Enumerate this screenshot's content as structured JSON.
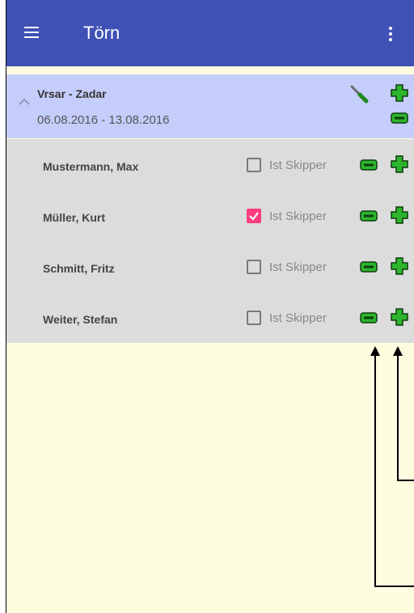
{
  "appbar": {
    "title": "Törn",
    "menu_icon": "hamburger-menu-icon",
    "overflow_icon": "more-vert-icon",
    "color": "#3f51b5"
  },
  "trip": {
    "name": "Vrsar - Zadar",
    "dates": "06.08.2016 - 13.08.2016",
    "icons": [
      "chevron-up-icon",
      "wrench-icon",
      "plus-icon",
      "minus-icon"
    ],
    "background": "#c5cdfa"
  },
  "crew": [
    {
      "name": "Mustermann, Max",
      "skipper_label": "Ist Skipper",
      "is_skipper": false
    },
    {
      "name": "Müller, Kurt",
      "skipper_label": "Ist Skipper",
      "is_skipper": true
    },
    {
      "name": "Schmitt, Fritz",
      "skipper_label": "Ist Skipper",
      "is_skipper": false
    },
    {
      "name": "Weiter, Stefan",
      "skipper_label": "Ist Skipper",
      "is_skipper": false
    }
  ],
  "colors": {
    "accent": "#ff3d7f",
    "icon_green": "#2db52d",
    "page_background": "#fffde0"
  }
}
